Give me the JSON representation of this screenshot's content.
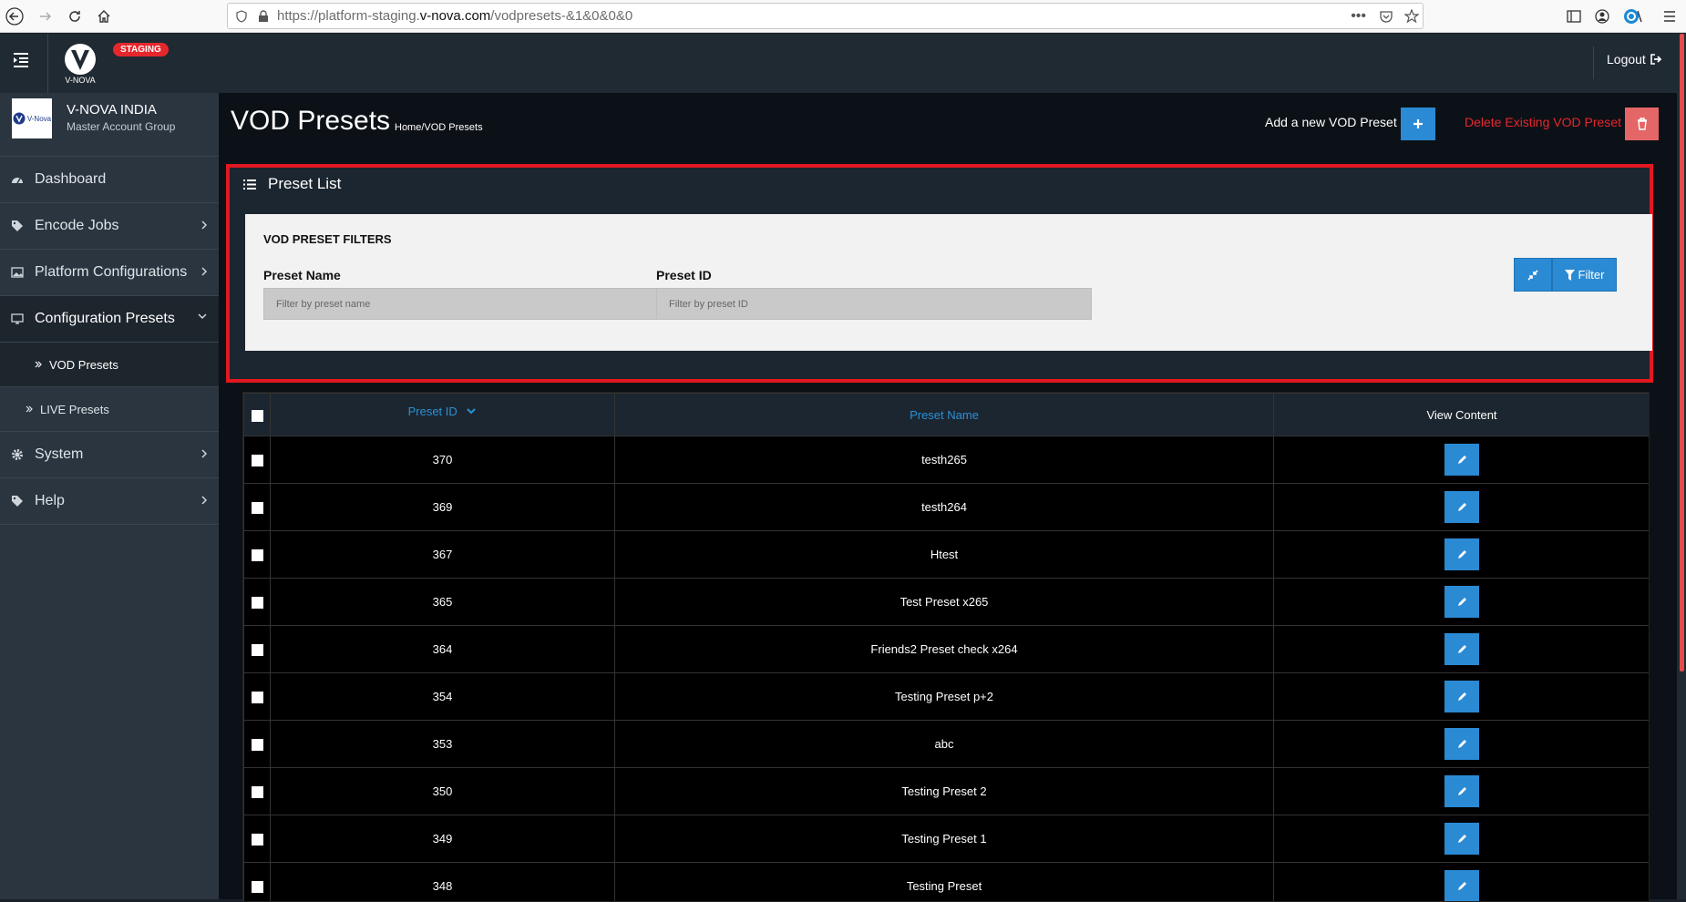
{
  "browser": {
    "url_prefix": "https://platform-staging.",
    "url_domain": "v-nova.com",
    "url_path": "/vodpresets-&1&0&0&0"
  },
  "header": {
    "brand": "V-NOVA",
    "env_badge": "STAGING",
    "logout_label": "Logout"
  },
  "account": {
    "logo_text": "V-Nova",
    "name": "V-NOVA INDIA",
    "group": "Master Account Group"
  },
  "sidebar": {
    "items": [
      {
        "label": "Dashboard",
        "icon": "dashboard-icon"
      },
      {
        "label": "Encode Jobs",
        "icon": "tags-icon"
      },
      {
        "label": "Platform Configurations",
        "icon": "image-icon"
      },
      {
        "label": "Configuration Presets",
        "icon": "desktop-icon"
      },
      {
        "label": "System",
        "icon": "gear-icon"
      },
      {
        "label": "Help",
        "icon": "tags-icon"
      }
    ],
    "sub_items": [
      {
        "label": "VOD Presets"
      },
      {
        "label": "LIVE Presets"
      }
    ]
  },
  "page": {
    "title": "VOD Presets",
    "breadcrumb_home": "Home",
    "breadcrumb_sep": "/",
    "breadcrumb_current": "VOD Presets",
    "add_label": "Add a new VOD Preset",
    "delete_label": "Delete Existing VOD Preset"
  },
  "panel": {
    "title": "Preset List",
    "filters_title": "VOD PRESET FILTERS",
    "preset_name_label": "Preset Name",
    "preset_name_placeholder": "Filter by preset name",
    "preset_id_label": "Preset ID",
    "preset_id_placeholder": "Filter by preset ID",
    "filter_label": "Filter"
  },
  "table": {
    "columns": [
      "Preset ID",
      "Preset Name",
      "View Content"
    ],
    "rows": [
      {
        "id": "370",
        "name": "testh265"
      },
      {
        "id": "369",
        "name": "testh264"
      },
      {
        "id": "367",
        "name": "Htest"
      },
      {
        "id": "365",
        "name": "Test Preset x265"
      },
      {
        "id": "364",
        "name": "Friends2 Preset check x264"
      },
      {
        "id": "354",
        "name": "Testing Preset p+2"
      },
      {
        "id": "353",
        "name": "abc"
      },
      {
        "id": "350",
        "name": "Testing Preset 2"
      },
      {
        "id": "349",
        "name": "Testing Preset 1"
      },
      {
        "id": "348",
        "name": "Testing Preset"
      }
    ]
  },
  "colors": {
    "accent_blue": "#2b8ad4",
    "danger_red": "#e5272d",
    "sidebar_bg": "#2a3540"
  }
}
